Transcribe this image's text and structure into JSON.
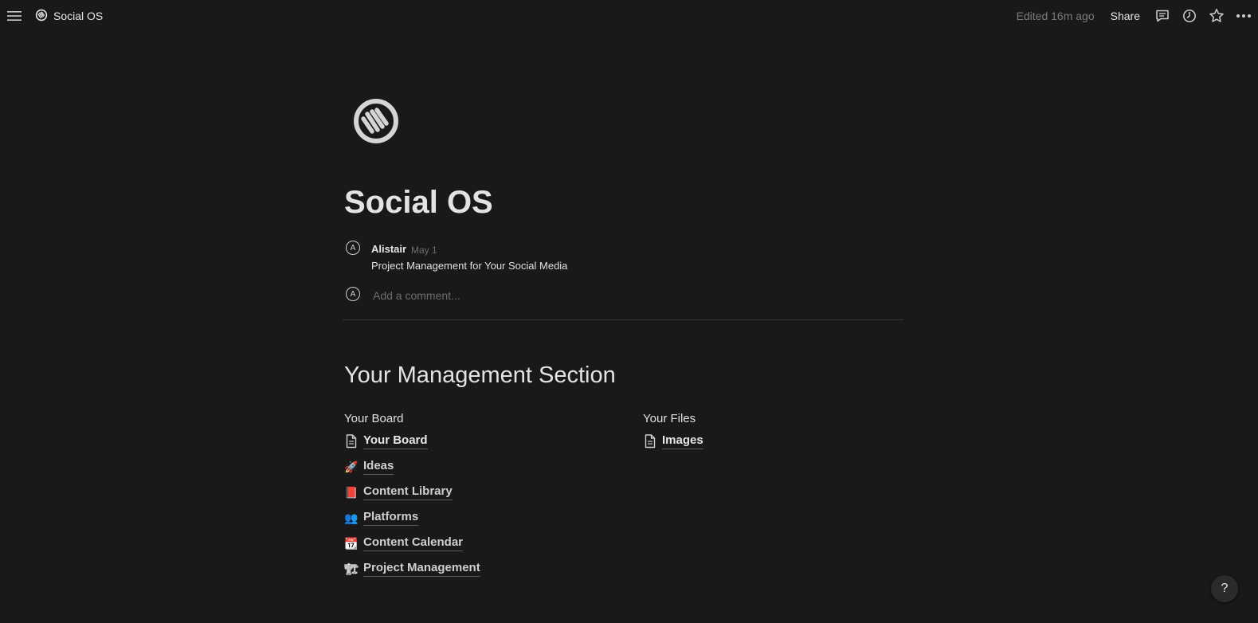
{
  "topbar": {
    "breadcrumb": "Social OS",
    "edited": "Edited 16m ago",
    "share": "Share"
  },
  "page": {
    "title": "Social OS",
    "icon": "social-os-logo-icon"
  },
  "comment": {
    "avatar_initial": "A",
    "author": "Alistair",
    "date": "May 1",
    "text": "Project Management for Your Social Media"
  },
  "add_comment": {
    "avatar_initial": "A",
    "placeholder": "Add a comment..."
  },
  "section": {
    "heading": "Your Management Section",
    "left_column": {
      "heading": "Your Board",
      "links": [
        {
          "label": "Your Board",
          "icon": "document-icon"
        },
        {
          "label": "Ideas",
          "icon": "🚀"
        },
        {
          "label": "Content Library",
          "icon": "📕"
        },
        {
          "label": "Platforms",
          "icon": "👥"
        },
        {
          "label": "Content Calendar",
          "icon": "📆"
        },
        {
          "label": "Project Management",
          "icon": "🏗"
        }
      ]
    },
    "right_column": {
      "heading": "Your Files",
      "links": [
        {
          "label": "Images",
          "icon": "document-icon"
        }
      ]
    }
  },
  "help": "?"
}
